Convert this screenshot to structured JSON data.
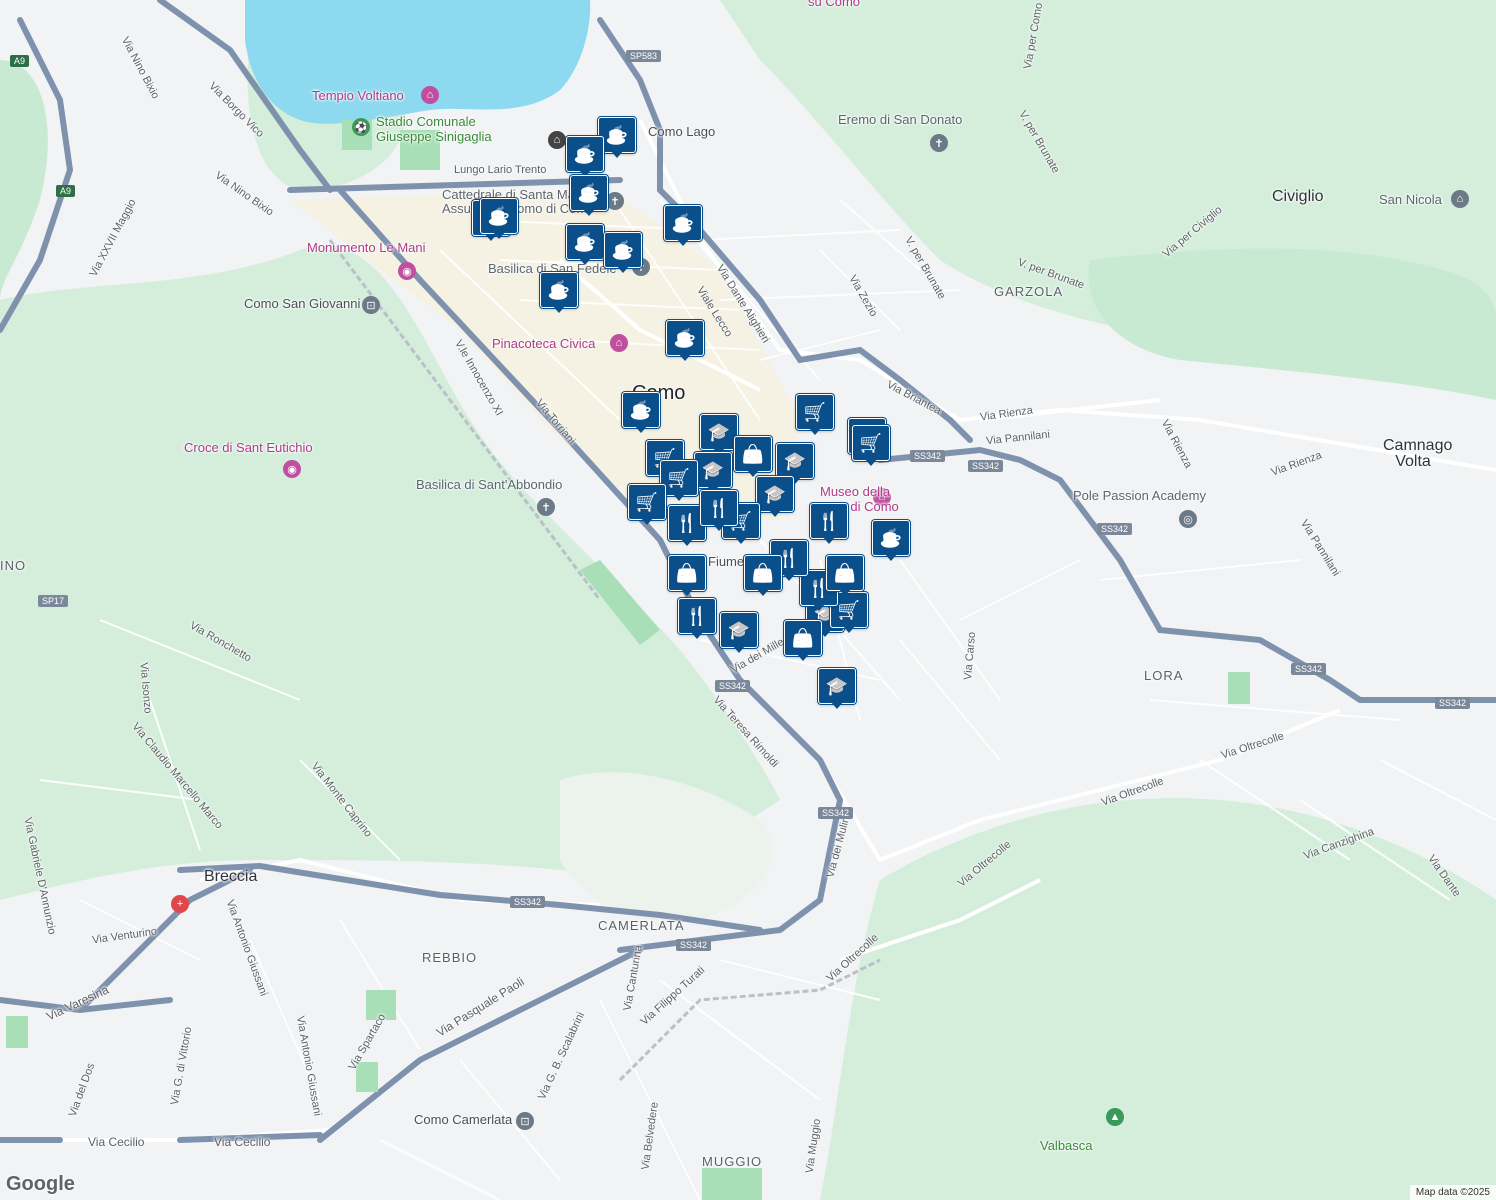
{
  "map": {
    "colors": {
      "land": "#f1f3f4",
      "park": "#c9ead2",
      "forest": "#d4eedb",
      "water": "#8ddaf0",
      "highway": "#7f92ad",
      "road": "#ffffff",
      "marker": "#0b4f8a"
    },
    "labels": {
      "city": "Como",
      "towns": [
        "Breccia",
        "Civiglio",
        "Camnago Volta"
      ],
      "areas": [
        "GARZOLA",
        "LORA",
        "REBBIO",
        "CAMERLATA",
        "MUGGIO",
        "INO"
      ],
      "pois": {
        "tempio": "Tempio Voltiano",
        "stadio": "Stadio Comunale Giuseppe Sinigaglia",
        "monumento": "Monumento Le Mani",
        "como_lago": "Como Lago",
        "cattedrale": "Cattedrale di Santa Maria Assunta - Duomo di Como",
        "basilica_fedele": "Basilica di San Fedele",
        "pinacoteca": "Pinacoteca Civica",
        "como_sg": "Como San Giovanni",
        "croce": "Croce di Sant Eutichio",
        "basilica_abbondio": "Basilica di Sant'Abbondio",
        "eremo": "Eremo di San Donato",
        "san_nicola": "San Nicola",
        "pole": "Pole Passion Academy",
        "museo": "Museo della Seta di Como",
        "como_camerlata": "Como Camerlata",
        "valbasca": "Valbasca",
        "su_como": "su Como",
        "via_fiume": "Fiume"
      },
      "streets": {
        "nino_bixio_1": "Via Nino Bixio",
        "nino_bixio_2": "Via Nino Bixio",
        "borgo_vico": "Via Borgo Vico",
        "xxvii_maggio": "Via XXVII Maggio",
        "lungo_lario": "Lungo Lario Trento",
        "dante": "Via Dante Alighieri",
        "lecco": "Viale Lecco",
        "innocenzo": "V.le Innocenzo XI",
        "torriani": "Via Torriani",
        "zezio": "Via Zezio",
        "brianteà": "Via Briantea",
        "rienza_1": "Via Rienza",
        "rienza_2": "Via Rienza",
        "rienza_3": "Via Rienza",
        "pannilani_1": "Via Pannilani",
        "pannilani_2": "Via Pannilani",
        "per_brunate_1": "V. per Brunate",
        "per_brunate_2": "V. per Brunate",
        "per_brunate_3": "V. per Brunate",
        "per_como": "Via per Como",
        "per_civiglio": "Via per Civiglio",
        "ronchetto": "Via Ronchetto",
        "isonzo": "Via Isonzo",
        "claudio": "Via Claudio Marcello Marco",
        "gabriele": "Via Gabriele D'Annunzio",
        "monte_caprino": "Via Monte Caprino",
        "teresa": "Via Teresa Rimoldi",
        "carso": "Via Carso",
        "mille": "Via dei Mille",
        "mulini": "Via dei Mulini",
        "oltrecolle_1": "Via Oltrecolle",
        "oltrecolle_2": "Via Oltrecolle",
        "oltrecolle_3": "Via Oltrecolle",
        "oltrecolle_4": "Via Oltrecolle",
        "canzighina": "Via Canzighina",
        "dante_2": "Via Dante",
        "venturino": "Via Venturino",
        "varesina": "Via Varesina",
        "giussani_1": "Via Antonio Giussani",
        "giussani_2": "Via Antonio Giussani",
        "spartaco": "Via Spartaco",
        "paoli": "Via Pasquale Paoli",
        "canturina": "Via Canturina",
        "turati": "Via Filippo Turati",
        "scalabrini": "Via G. B. Scalabrini",
        "vittorio": "Via G. di Vittorio",
        "dos": "Via del Dos",
        "cecilio_1": "Via Cecilio",
        "cecilio_2": "Via Cecilio",
        "belvedere": "Via Belvedere",
        "muggio": "Via Muggio"
      },
      "shields": [
        "A9",
        "A9",
        "SP583",
        "SS342",
        "SS342",
        "SS342",
        "SS342",
        "SS342",
        "SS342",
        "SS342",
        "SS342",
        "SS342",
        "SP17"
      ]
    },
    "markers": [
      "coffee",
      "coffee",
      "coffee",
      "coffee",
      "coffee",
      "coffee",
      "coffee",
      "coffee",
      "coffee",
      "coffee",
      "coffee",
      "coffee",
      "school",
      "school",
      "school",
      "school",
      "school",
      "school",
      "school",
      "cart",
      "cart",
      "cart",
      "cart",
      "cart",
      "cart",
      "cart",
      "cart",
      "food",
      "food",
      "food",
      "food",
      "food",
      "food",
      "bag",
      "bag",
      "bag",
      "bag",
      "bag"
    ],
    "google": "Google",
    "attribution": "Map data ©2025"
  }
}
